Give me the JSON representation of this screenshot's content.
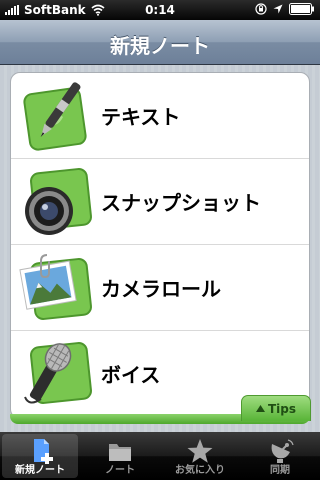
{
  "status_bar": {
    "carrier": "SoftBank",
    "time": "0:14"
  },
  "nav": {
    "title": "新規ノート"
  },
  "actions": [
    {
      "label": "テキスト",
      "icon": "pen-icon"
    },
    {
      "label": "スナップショット",
      "icon": "camera-lens-icon"
    },
    {
      "label": "カメラロール",
      "icon": "photo-icon"
    },
    {
      "label": "ボイス",
      "icon": "microphone-icon"
    }
  ],
  "tips": {
    "label": "Tips"
  },
  "tabs": [
    {
      "label": "新規ノート",
      "icon": "new-note-icon",
      "selected": true
    },
    {
      "label": "ノート",
      "icon": "folder-icon",
      "selected": false
    },
    {
      "label": "お気に入り",
      "icon": "star-icon",
      "selected": false
    },
    {
      "label": "同期",
      "icon": "satellite-icon",
      "selected": false
    }
  ],
  "colors": {
    "accent_green": "#58b437",
    "nav_blue": "#7a8ca3"
  }
}
